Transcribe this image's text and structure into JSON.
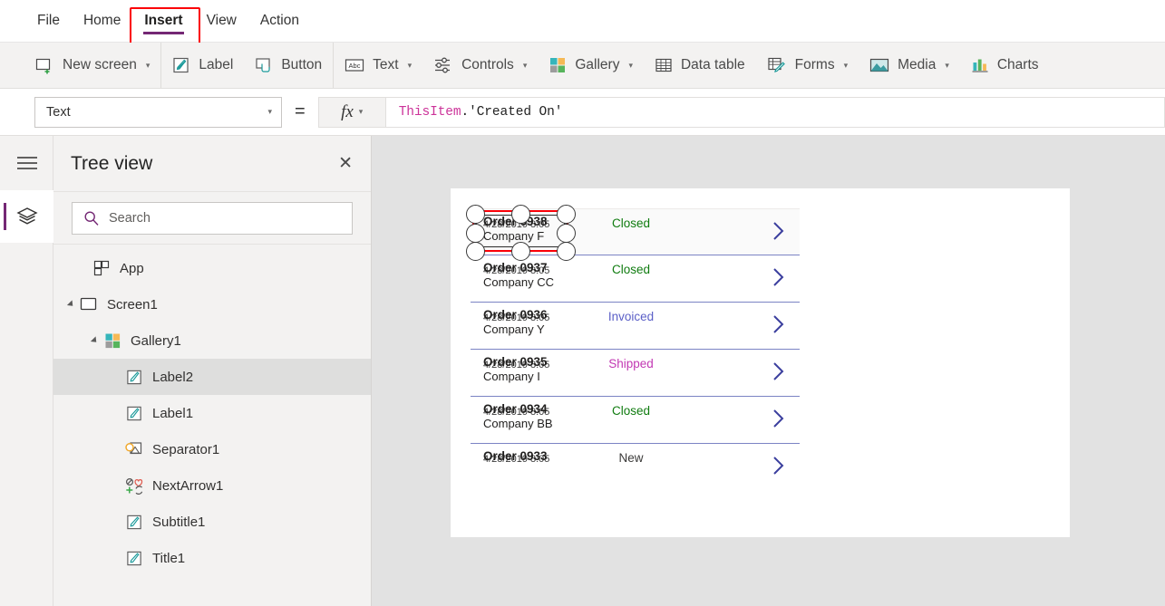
{
  "menubar": {
    "items": [
      {
        "label": "File",
        "active": false
      },
      {
        "label": "Home",
        "active": false
      },
      {
        "label": "Insert",
        "active": true
      },
      {
        "label": "View",
        "active": false
      },
      {
        "label": "Action",
        "active": false
      }
    ]
  },
  "ribbon": {
    "items": [
      {
        "label": "New screen",
        "icon": "new-screen-icon",
        "caret": true
      },
      {
        "label": "Label",
        "icon": "label-icon",
        "caret": false,
        "highlighted": true
      },
      {
        "label": "Button",
        "icon": "button-icon",
        "caret": false
      },
      {
        "label": "Text",
        "icon": "text-abc-icon",
        "caret": true
      },
      {
        "label": "Controls",
        "icon": "controls-sliders-icon",
        "caret": true
      },
      {
        "label": "Gallery",
        "icon": "gallery-grid-icon",
        "caret": true
      },
      {
        "label": "Data table",
        "icon": "data-table-icon",
        "caret": false
      },
      {
        "label": "Forms",
        "icon": "forms-icon",
        "caret": true
      },
      {
        "label": "Media",
        "icon": "media-image-icon",
        "caret": true
      },
      {
        "label": "Charts",
        "icon": "charts-bar-icon",
        "caret": false
      }
    ]
  },
  "formula_bar": {
    "property": "Text",
    "equals": "=",
    "fx_label": "fx",
    "formula_object": "ThisItem",
    "formula_dot": ".",
    "formula_field": "'Created On'"
  },
  "tree_view": {
    "title": "Tree view",
    "close_label": "✕",
    "search_placeholder": "Search",
    "items": [
      {
        "label": "App",
        "depth": 0,
        "icon": "app-icon",
        "expandable": false,
        "selected": false
      },
      {
        "label": "Screen1",
        "depth": 1,
        "icon": "screen-icon",
        "expandable": true,
        "selected": false
      },
      {
        "label": "Gallery1",
        "depth": 2,
        "icon": "gallery-icon",
        "expandable": true,
        "selected": false
      },
      {
        "label": "Label2",
        "depth": 3,
        "icon": "label-icon",
        "expandable": false,
        "selected": true
      },
      {
        "label": "Label1",
        "depth": 3,
        "icon": "label-icon",
        "expandable": false,
        "selected": false
      },
      {
        "label": "Separator1",
        "depth": 3,
        "icon": "separator-icon",
        "expandable": false,
        "selected": false
      },
      {
        "label": "NextArrow1",
        "depth": 3,
        "icon": "next-arrow-icon",
        "expandable": false,
        "selected": false
      },
      {
        "label": "Subtitle1",
        "depth": 3,
        "icon": "label-icon",
        "expandable": false,
        "selected": false
      },
      {
        "label": "Title1",
        "depth": 3,
        "icon": "label-icon",
        "expandable": false,
        "selected": false
      }
    ]
  },
  "colors": {
    "accent_purple": "#742774",
    "selection_red": "#fb0007",
    "status_closed": "#107c10",
    "status_invoiced": "#5b5fc7",
    "status_shipped": "#c239b3",
    "status_new": "#3b3a39",
    "row_divider": "#7b83c4"
  },
  "gallery": {
    "rows": [
      {
        "title": "Order 0938",
        "date": "4/28/2019 8:05",
        "subtitle": "Company F",
        "status": "Closed",
        "status_color": "#107c10",
        "selected": true
      },
      {
        "title": "Order 0937",
        "date": "4/28/2019 8:05",
        "subtitle": "Company CC",
        "status": "Closed",
        "status_color": "#107c10",
        "selected": false
      },
      {
        "title": "Order 0936",
        "date": "4/28/2019 8:05",
        "subtitle": "Company Y",
        "status": "Invoiced",
        "status_color": "#5b5fc7",
        "selected": false
      },
      {
        "title": "Order 0935",
        "date": "4/28/2019 8:05",
        "subtitle": "Company I",
        "status": "Shipped",
        "status_color": "#c239b3",
        "selected": false
      },
      {
        "title": "Order 0934",
        "date": "4/28/2019 8:05",
        "subtitle": "Company BB",
        "status": "Closed",
        "status_color": "#107c10",
        "selected": false
      },
      {
        "title": "Order 0933",
        "date": "4/28/2019 8:05",
        "subtitle": "",
        "status": "New",
        "status_color": "#3b3a39",
        "selected": false
      }
    ]
  }
}
